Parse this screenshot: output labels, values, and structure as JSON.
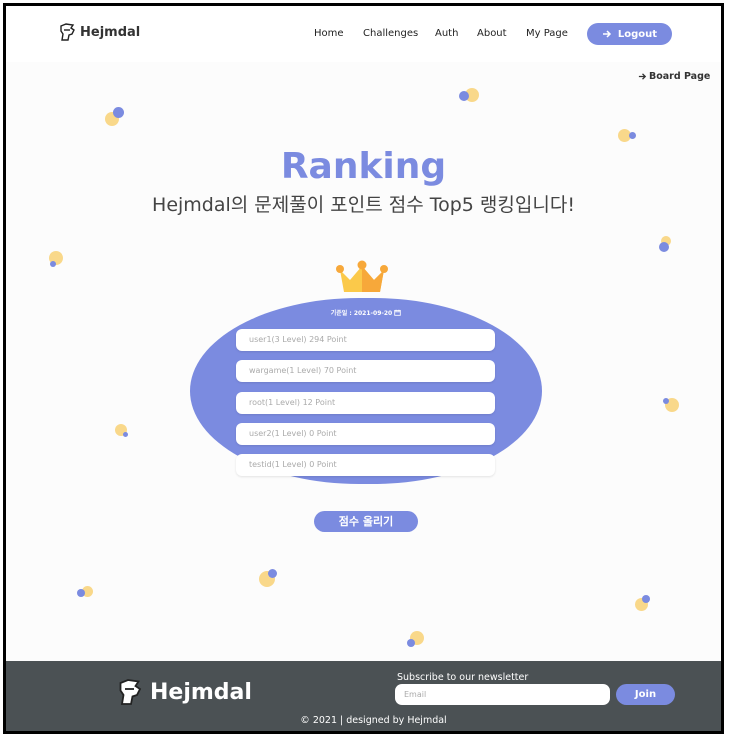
{
  "nav": {
    "logo": "Hejmdal",
    "links": [
      "Home",
      "Challenges",
      "Auth",
      "About",
      "My Page"
    ],
    "logout_label": "Logout",
    "board_link": "Board Page"
  },
  "hero": {
    "title": "Ranking",
    "subtitle": "Hejmdal의 문제풀이 포인트 점수 Top5 랭킹입니다!"
  },
  "ranking": {
    "date_label": "기준일 : 2021-09-20",
    "rows": [
      "user1(3 Level) 294 Point",
      "wargame(1 Level) 70 Point",
      "root(1 Level) 12 Point",
      "user2(1 Level) 0 Point",
      "testid(1 Level) 0 Point"
    ],
    "score_button": "점수 올리기"
  },
  "footer": {
    "logo": "Hejmdal",
    "newsletter_label": "Subscribe to our newsletter",
    "email_placeholder": "Email",
    "join_label": "Join",
    "copyright": "© 2021 | designed by Hejmdal"
  },
  "colors": {
    "accent": "#7b8be0",
    "dot_yellow": "#f9d88a",
    "footer_bg": "#4b5154"
  },
  "icons": [
    "knight-logo-icon",
    "arrow-right-icon",
    "crown-icon",
    "calendar-icon"
  ]
}
